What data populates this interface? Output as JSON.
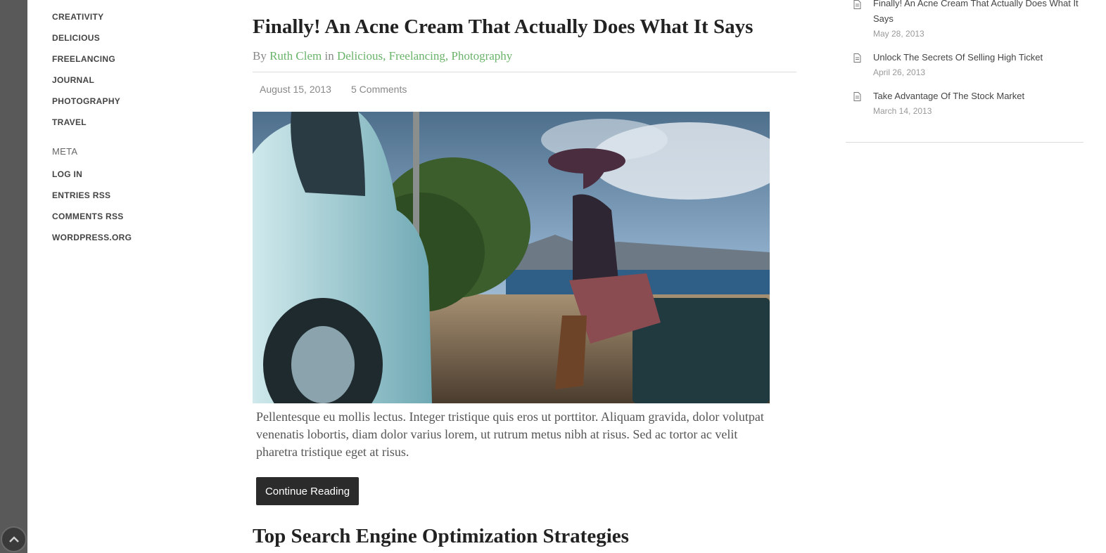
{
  "sidebar": {
    "categories": [
      "CREATIVITY",
      "DELICIOUS",
      "FREELANCING",
      "JOURNAL",
      "PHOTOGRAPHY",
      "TRAVEL"
    ],
    "meta_title": "META",
    "meta_links": [
      "LOG IN",
      "ENTRIES RSS",
      "COMMENTS RSS",
      "WORDPRESS.ORG"
    ]
  },
  "post": {
    "title": "Finally! An Acne Cream That Actually Does What It Says",
    "by_label": "By",
    "author": "Ruth Clem",
    "in_label": "in",
    "categories": [
      "Delicious",
      "Freelancing",
      "Photography"
    ],
    "date": "August 15, 2013",
    "comments": "5 Comments",
    "excerpt": "Pellentesque eu mollis lectus. Integer tristique quis eros ut porttitor. Aliquam gravida, dolor volutpat venenatis lobortis, diam dolor varius lorem, ut rutrum metus nibh at risus. Sed ac tortor ac velit pharetra tristique eget at risus.",
    "continue_label": "Continue Reading"
  },
  "next_post": {
    "title": "Top Search Engine Optimization Strategies"
  },
  "recent_posts": [
    {
      "title": "Finally! An Acne Cream That Actually Does What It Says",
      "date": "May 28, 2013"
    },
    {
      "title": "Unlock The Secrets Of Selling High Ticket",
      "date": "April 26, 2013"
    },
    {
      "title": "Take Advantage Of The Stock Market",
      "date": "March 14, 2013"
    }
  ],
  "icons": {
    "scroll_top": "chevron-up-icon",
    "recent_post": "document-icon"
  },
  "colors": {
    "accent": "#6ab36a",
    "button": "#2b2b2b",
    "strip": "#595959"
  }
}
